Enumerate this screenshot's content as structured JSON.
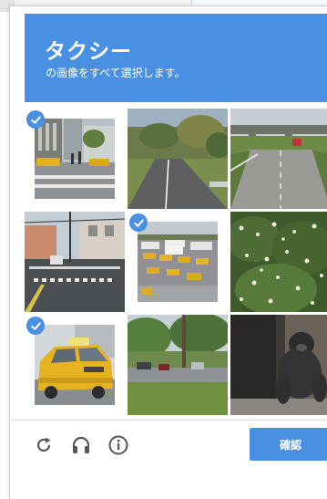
{
  "challenge": {
    "title": "タクシー",
    "instruction": "の画像をすべて選択します。"
  },
  "tiles": [
    {
      "row": 1,
      "col": 1,
      "content": "city-street-taxi",
      "selected": true
    },
    {
      "row": 1,
      "col": 2,
      "content": "country-road",
      "selected": false
    },
    {
      "row": 1,
      "col": 3,
      "content": "highway-overpass",
      "selected": false
    },
    {
      "row": 2,
      "col": 1,
      "content": "street-intersection",
      "selected": false
    },
    {
      "row": 2,
      "col": 2,
      "content": "parking-lot-taxis",
      "selected": true
    },
    {
      "row": 2,
      "col": 3,
      "content": "flowering-shrub",
      "selected": false
    },
    {
      "row": 3,
      "col": 1,
      "content": "yellow-taxi",
      "selected": true
    },
    {
      "row": 3,
      "col": 2,
      "content": "street-trees",
      "selected": false
    },
    {
      "row": 3,
      "col": 3,
      "content": "gorilla-statue",
      "selected": false
    }
  ],
  "footer": {
    "reload_icon": "reload-icon",
    "audio_icon": "headphones-icon",
    "info_icon": "info-icon",
    "verify_label": "確認"
  },
  "colors": {
    "accent": "#4a90e2"
  }
}
